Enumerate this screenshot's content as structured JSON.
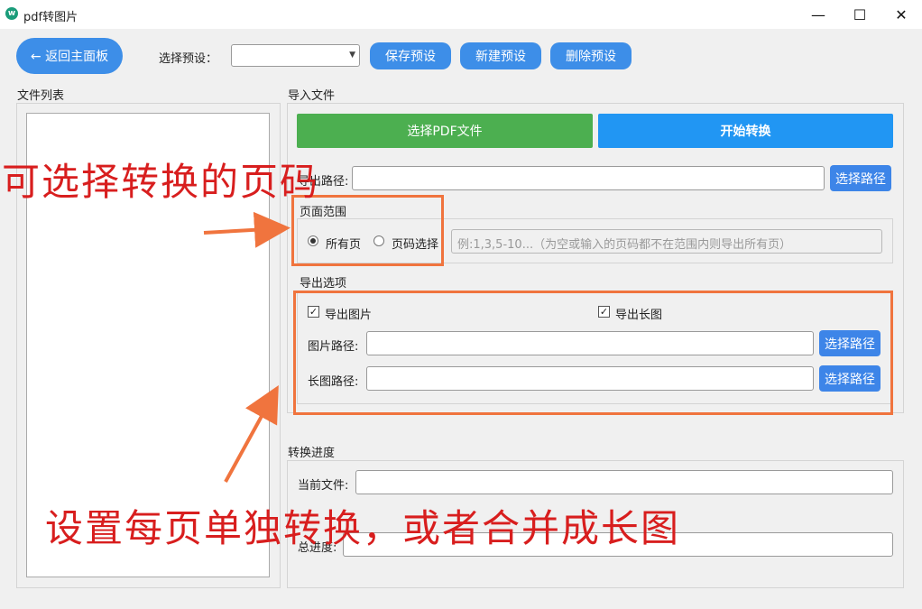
{
  "window": {
    "title": "pdf转图片",
    "icon_letter": "w"
  },
  "toolbar": {
    "back_label": "← 返回主面板",
    "preset_label": "选择预设：",
    "preset_value": "",
    "save_preset": "保存预设",
    "new_preset": "新建预设",
    "delete_preset": "删除预设"
  },
  "file_list": {
    "title": "文件列表"
  },
  "import": {
    "title": "导入文件",
    "select_pdf": "选择PDF文件",
    "start": "开始转换",
    "output_path_label": "导出路径:",
    "output_path_value": "",
    "choose_path": "选择路径"
  },
  "page_range": {
    "title": "页面范围",
    "all_pages": "所有页",
    "page_select": "页码选择",
    "placeholder": "例:1,3,5-10...（为空或输入的页码都不在范围内则导出所有页）",
    "selected": "all"
  },
  "export_options": {
    "title": "导出选项",
    "export_images": "导出图片",
    "export_long": "导出长图",
    "export_images_checked": true,
    "export_long_checked": true,
    "image_path_label": "图片路径:",
    "image_path_value": "",
    "long_path_label": "长图路径:",
    "long_path_value": "",
    "choose_path": "选择路径"
  },
  "progress": {
    "title": "转换进度",
    "current_file_label": "当前文件:",
    "current_file_value": "",
    "total_label": "总进度:",
    "total_value": ""
  },
  "annotations": {
    "top": "可选择转换的页码",
    "bottom": "设置每页单独转换，或者合并成长图"
  },
  "colors": {
    "accent": "#3d85e8",
    "green": "#4caf50",
    "blue": "#2196f3",
    "annotation": "#f0743e",
    "annotation_text": "#d81e1e"
  }
}
